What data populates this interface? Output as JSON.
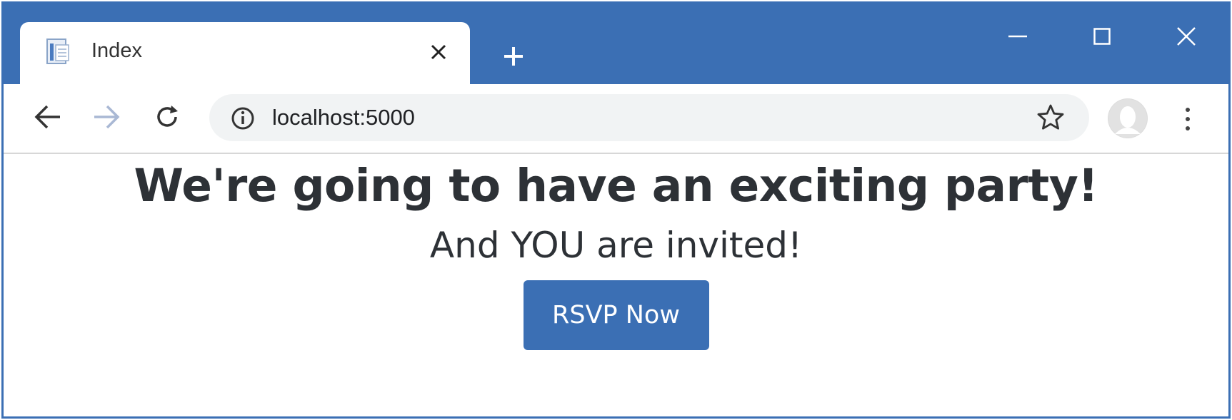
{
  "browser": {
    "tab": {
      "title": "Index"
    },
    "address_bar": {
      "url": "localhost:5000"
    }
  },
  "page": {
    "headline": "We're going to have an exciting party!",
    "subheadline": "And YOU are invited!",
    "rsvp_button": "RSVP Now"
  },
  "colors": {
    "chrome_accent": "#3b6fb4",
    "button_bg": "#3b6fb4",
    "button_text": "#ffffff",
    "heading_text": "#2d3136"
  },
  "icons": [
    "page-icon",
    "close-icon",
    "plus-icon",
    "minimize-icon",
    "maximize-icon",
    "back-arrow-icon",
    "forward-arrow-icon",
    "reload-icon",
    "info-icon",
    "star-icon",
    "profile-avatar",
    "kebab-menu-icon"
  ]
}
